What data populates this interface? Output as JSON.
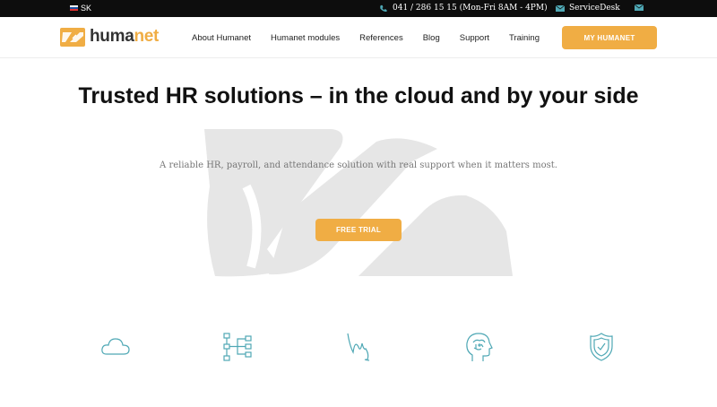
{
  "topbar": {
    "language": "SK",
    "phone": "041 / 286 15 15  (Mon-Fri 8AM - 4PM)",
    "service_desk": "ServiceDesk",
    "icons": [
      "flag-sk-icon",
      "phone-icon",
      "mail-icon",
      "mail-icon"
    ]
  },
  "header": {
    "logo_text_dark": "huma",
    "logo_text_accent": "net",
    "nav": [
      "About Humanet",
      "Humanet modules",
      "References",
      "Blog",
      "Support",
      "Training"
    ],
    "cta_label": "MY HUMANET"
  },
  "hero": {
    "title": "Trusted HR solutions – in the cloud and by your side",
    "subtitle": "A reliable HR, payroll, and attendance solution with real support when it matters most.",
    "cta_label": "FREE TRIAL"
  },
  "features": {
    "icons": [
      "cloud-icon",
      "org-chart-icon",
      "signature-icon",
      "brain-head-icon",
      "shield-icon"
    ]
  },
  "colors": {
    "accent": "#f0ad44",
    "icon": "#4fa8b5",
    "topbar": "#0d0d0d",
    "watermark": "#e6e6e6"
  }
}
